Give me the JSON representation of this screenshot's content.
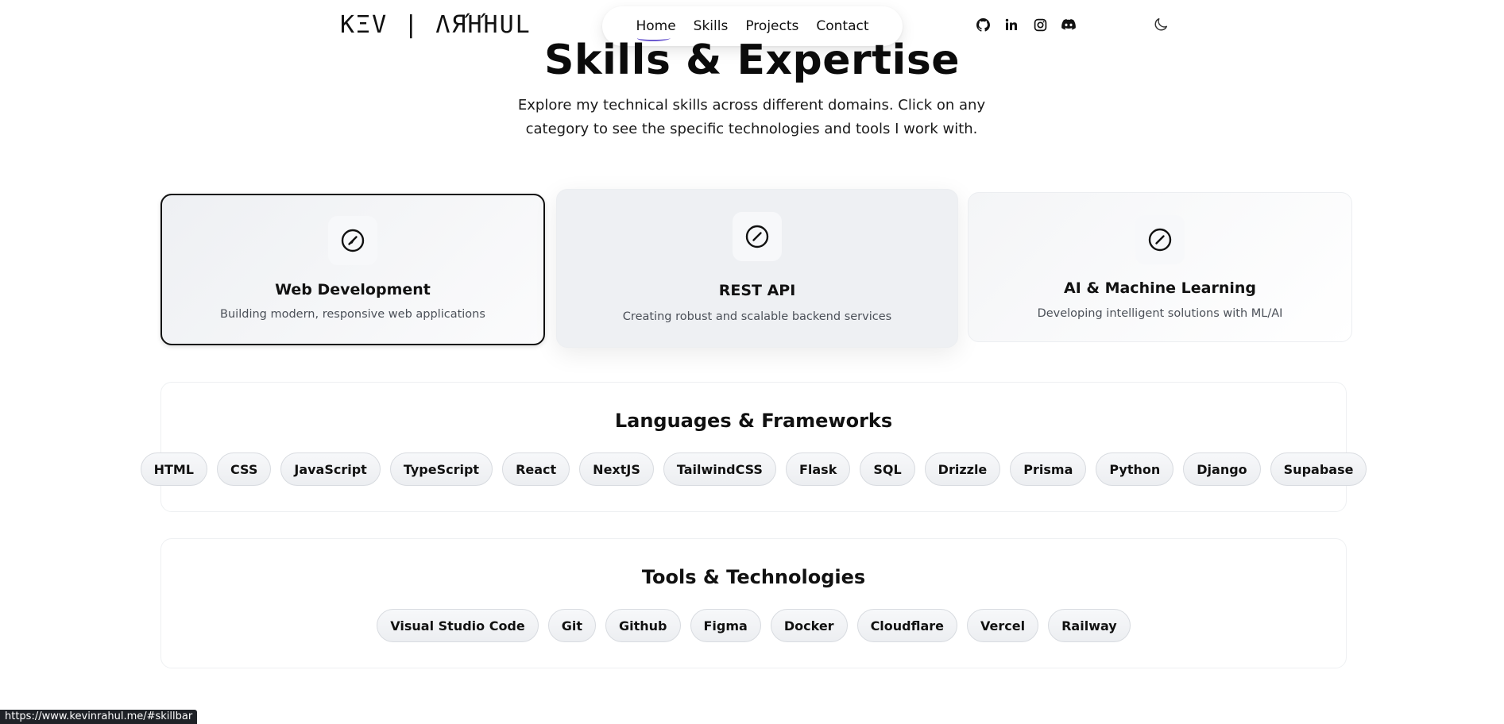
{
  "header": {
    "logo": "ΚΞV | ΛЯΉΉUL",
    "nav": [
      {
        "label": "Home",
        "active": true
      },
      {
        "label": "Skills",
        "active": false
      },
      {
        "label": "Projects",
        "active": false
      },
      {
        "label": "Contact",
        "active": false
      }
    ],
    "socials": [
      "github-icon",
      "linkedin-icon",
      "instagram-icon",
      "discord-icon"
    ],
    "theme_icon": "moon-icon"
  },
  "hero": {
    "title": "Skills & Expertise",
    "subtitle": "Explore my technical skills across different domains. Click on any category to see the specific technologies and tools I work with."
  },
  "categories": [
    {
      "title": "Web Development",
      "desc": "Building modern, responsive web applications",
      "icon": "compass-icon",
      "state": "selected"
    },
    {
      "title": "REST API",
      "desc": "Creating robust and scalable backend services",
      "icon": "compass-icon",
      "state": "hover"
    },
    {
      "title": "AI & Machine Learning",
      "desc": "Developing intelligent solutions with ML/AI",
      "icon": "compass-icon",
      "state": "normal"
    }
  ],
  "languages": {
    "title": "Languages & Frameworks",
    "items": [
      "HTML",
      "CSS",
      "JavaScript",
      "TypeScript",
      "React",
      "NextJS",
      "TailwindCSS",
      "Flask",
      "SQL",
      "Drizzle",
      "Prisma",
      "Python",
      "Django",
      "Supabase"
    ]
  },
  "tools": {
    "title": "Tools & Technologies",
    "items": [
      "Visual Studio Code",
      "Git",
      "Github",
      "Figma",
      "Docker",
      "Cloudflare",
      "Vercel",
      "Railway"
    ]
  },
  "status_url": "https://www.kevinrahul.me/#skillbar",
  "colors": {
    "accent": "#6d5bd0",
    "text": "#0a0a0a",
    "muted": "#4b5058"
  }
}
